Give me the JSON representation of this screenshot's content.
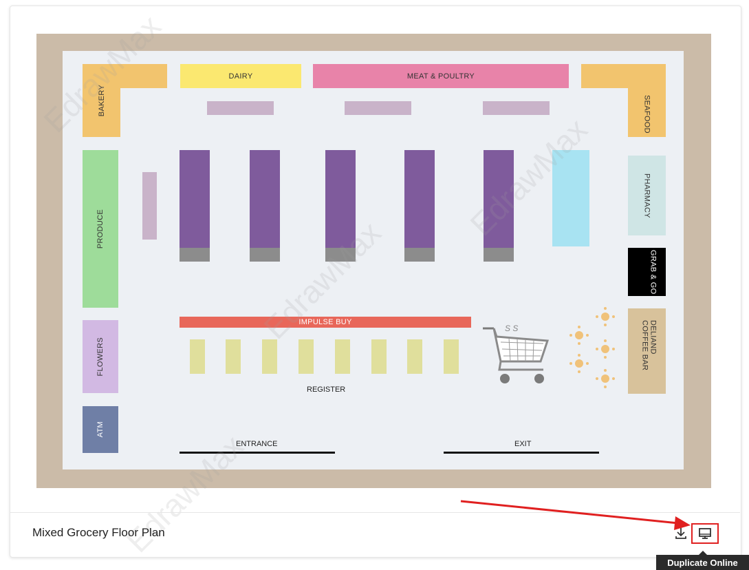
{
  "template": {
    "title": "Mixed Grocery Floor Plan",
    "tooltip": "Duplicate Online"
  },
  "floor_plan": {
    "zones": {
      "bakery": "BAKERY",
      "dairy": "DAIRY",
      "meat": "MEAT & POULTRY",
      "seafood": "SEAFOOD",
      "pharmacy": "PHARMACY",
      "grab_go": "GRAB & GO",
      "deli": "DELIAND COFFEE BAR",
      "produce": "PRODUCE",
      "flowers": "FLOWERS",
      "atm": "ATM",
      "impulse": "IMPULSE BUY",
      "register": "REGISTER",
      "entrance": "ENTRANCE",
      "exit": "EXIT",
      "cart_brand": "S  S"
    },
    "colors": {
      "frame": "#cbbba8",
      "floor": "#edf0f4",
      "bakery": "#f2c46e",
      "dairy": "#fbe870",
      "meat": "#e883a9",
      "pharmacy": "#cfe5e5",
      "grab_go": "#000000",
      "deli": "#d8c29b",
      "produce": "#9edc9a",
      "flowers": "#d2b9e3",
      "atm": "#6f7fa6",
      "impulse": "#e8675a",
      "shelf": "#7f5b9c",
      "cooler": "#a8e3f2",
      "register": "#e0df9c"
    }
  },
  "watermark": "EdrawMax",
  "annotation_color": "#e02020"
}
